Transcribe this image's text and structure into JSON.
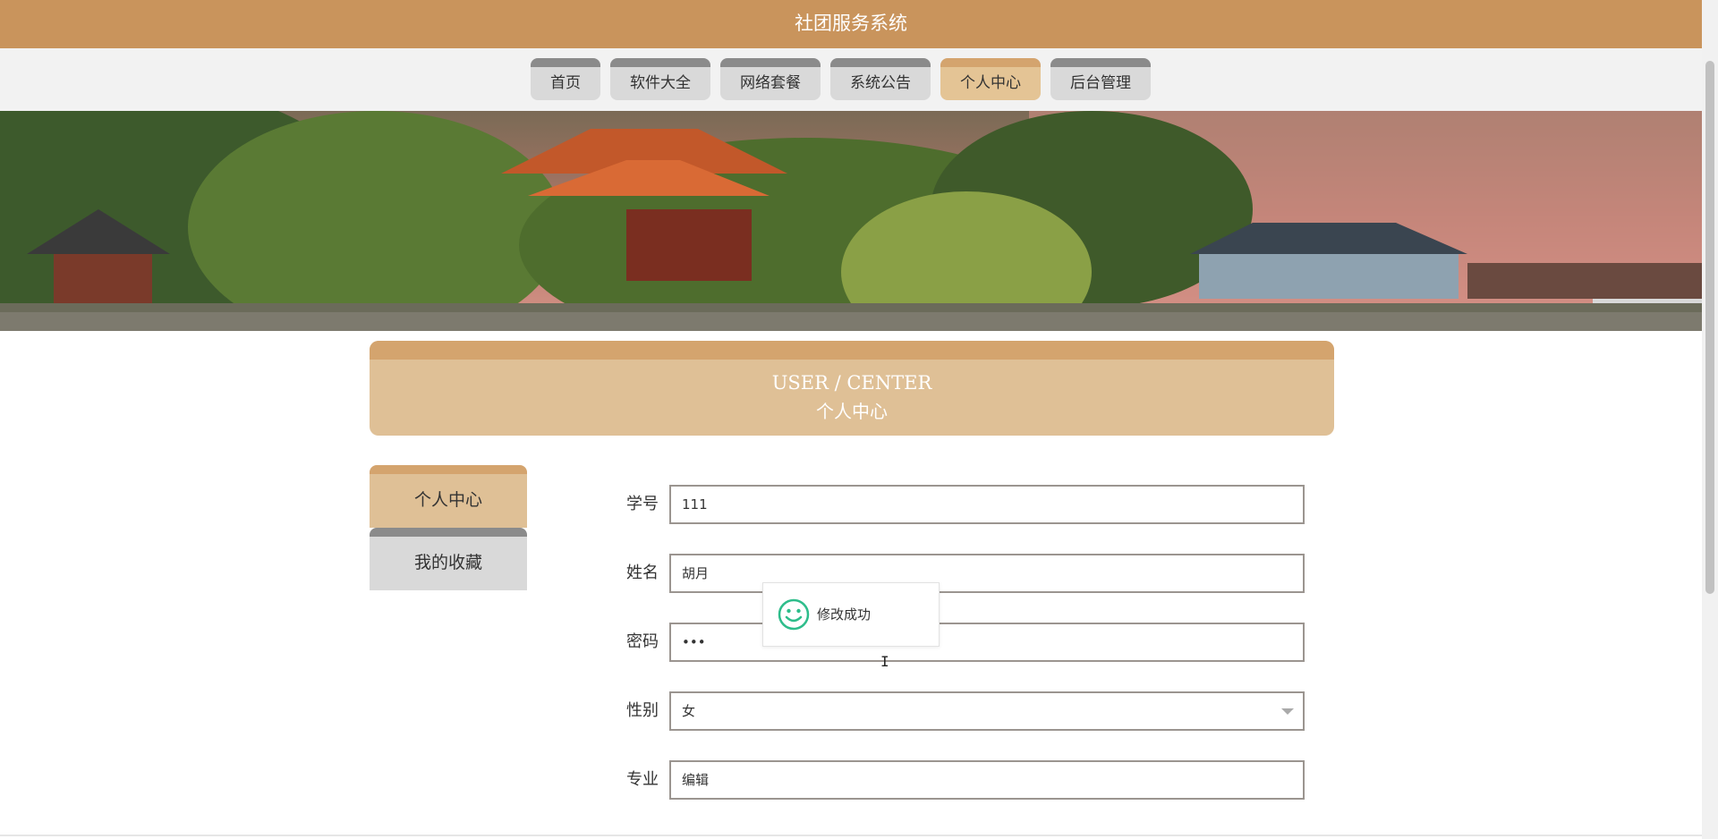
{
  "header": {
    "title": "社团服务系统"
  },
  "nav": {
    "items": [
      {
        "label": "首页"
      },
      {
        "label": "软件大全"
      },
      {
        "label": "网络套餐"
      },
      {
        "label": "系统公告"
      },
      {
        "label": "个人中心",
        "active": true
      },
      {
        "label": "后台管理"
      }
    ]
  },
  "banner": {
    "description_icon": "landscape-banner"
  },
  "section_title": {
    "en": "USER / CENTER",
    "cn": "个人中心"
  },
  "sidebar": {
    "items": [
      {
        "label": "个人中心",
        "active": true
      },
      {
        "label": "我的收藏"
      }
    ]
  },
  "form": {
    "fields": [
      {
        "label": "学号",
        "value": "111"
      },
      {
        "label": "姓名",
        "value": "胡月"
      },
      {
        "label": "密码",
        "value": "•••"
      },
      {
        "label": "性别",
        "value": "女"
      },
      {
        "label": "专业",
        "value": "编辑"
      }
    ]
  },
  "toast": {
    "message": "修改成功",
    "icon": "smiley-icon"
  },
  "colors": {
    "header_bg": "#c9945c",
    "accent": "#d4a46e",
    "active_bg": "#e4c495",
    "success": "#2ebd8b"
  }
}
